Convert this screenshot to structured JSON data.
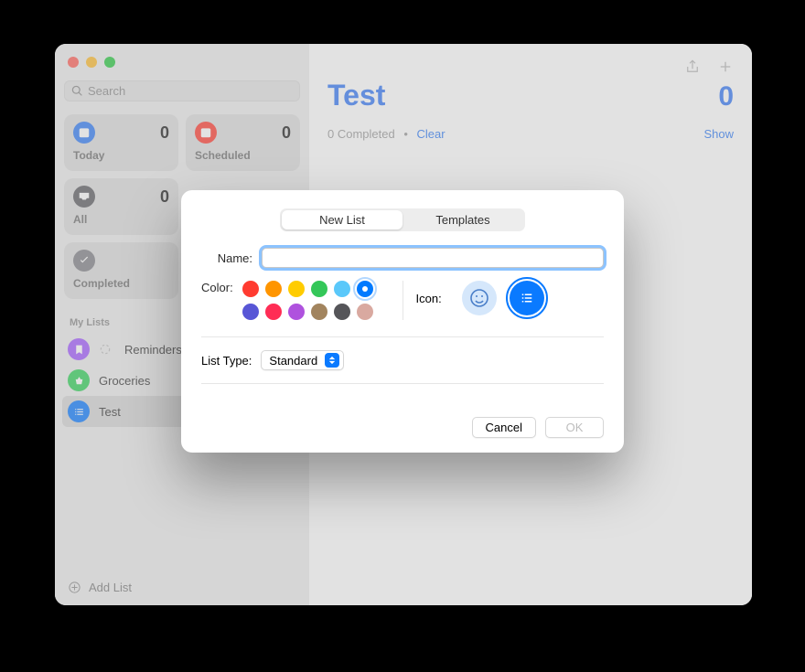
{
  "search": {
    "placeholder": "Search"
  },
  "tiles": {
    "today": {
      "label": "Today",
      "count": "0",
      "color": "#2f7bf6"
    },
    "scheduled": {
      "label": "Scheduled",
      "count": "0",
      "color": "#ff3b30"
    },
    "all": {
      "label": "All",
      "count": "0",
      "color": "#5b5b60"
    },
    "completed": {
      "label": "Completed",
      "color": "#808086"
    }
  },
  "sidebar": {
    "section": "My Lists",
    "items": [
      {
        "label": "Reminders",
        "color": "#a259ff"
      },
      {
        "label": "Groceries",
        "color": "#30d158"
      },
      {
        "label": "Test",
        "color": "#0a7aff"
      }
    ],
    "addList": "Add List"
  },
  "main": {
    "title": "Test",
    "count": "0",
    "completed": "0 Completed",
    "clear": "Clear",
    "show": "Show"
  },
  "modal": {
    "tabs": {
      "newList": "New List",
      "templates": "Templates"
    },
    "nameLabel": "Name:",
    "nameValue": "",
    "colorLabel": "Color:",
    "colors": [
      "#ff3b30",
      "#ff9500",
      "#ffcc00",
      "#34c759",
      "#5ac8fa",
      "#007aff",
      "#5856d6",
      "#ff2d55",
      "#af52de",
      "#a2845e",
      "#555559",
      "#d9a9a0"
    ],
    "selectedColorIndex": 5,
    "iconLabel": "Icon:",
    "typeLabel": "List Type:",
    "typeValue": "Standard",
    "cancel": "Cancel",
    "ok": "OK"
  }
}
